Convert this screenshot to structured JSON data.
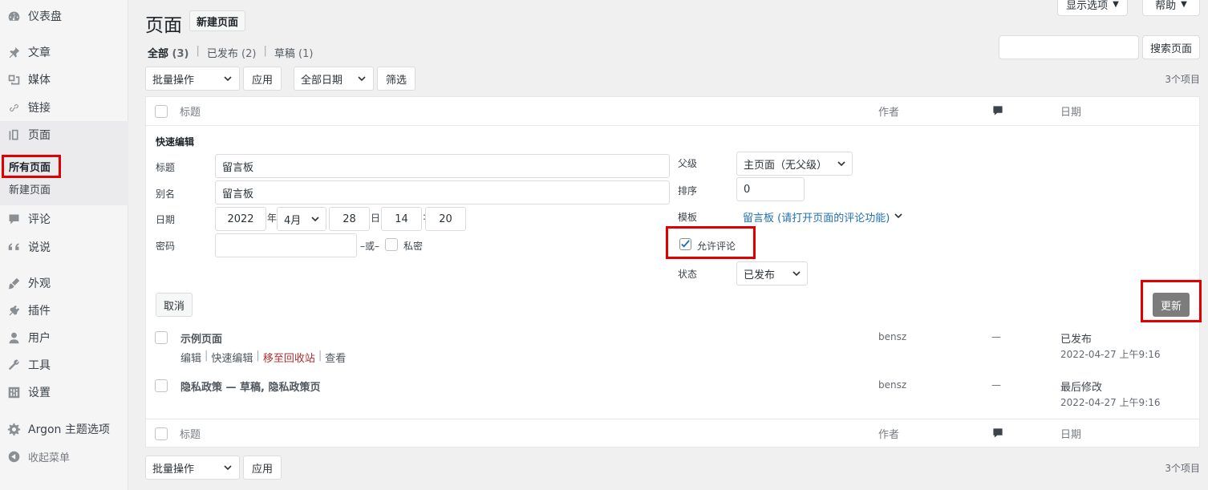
{
  "sidebar": {
    "items": [
      {
        "label": "仪表盘",
        "icon": "dashboard-icon"
      },
      {
        "label": "文章",
        "icon": "pin-icon"
      },
      {
        "label": "媒体",
        "icon": "media-icon"
      },
      {
        "label": "链接",
        "icon": "link-icon"
      },
      {
        "label": "页面",
        "icon": "pages-icon"
      },
      {
        "label": "评论",
        "icon": "comment-icon"
      },
      {
        "label": "说说",
        "icon": "quote-icon"
      },
      {
        "label": "外观",
        "icon": "brush-icon"
      },
      {
        "label": "插件",
        "icon": "plugin-icon"
      },
      {
        "label": "用户",
        "icon": "user-icon"
      },
      {
        "label": "工具",
        "icon": "wrench-icon"
      },
      {
        "label": "设置",
        "icon": "settings-icon"
      },
      {
        "label": "Argon 主题选项",
        "icon": "gear-icon"
      },
      {
        "label": "收起菜单",
        "icon": "collapse-icon"
      }
    ],
    "submenu": [
      {
        "label": "所有页面"
      },
      {
        "label": "新建页面"
      }
    ]
  },
  "header": {
    "title": "页面",
    "add_new": "新建页面",
    "screen_options": "显示选项",
    "help": "帮助"
  },
  "filters": [
    {
      "label": "全部",
      "count": "(3)"
    },
    {
      "label": "已发布",
      "count": "(2)"
    },
    {
      "label": "草稿",
      "count": "(1)"
    }
  ],
  "filter_sep": "|",
  "search": {
    "button": "搜索页面",
    "placeholder": ""
  },
  "toolbar": {
    "bulk_actions": "批量操作",
    "apply": "应用",
    "all_dates": "全部日期",
    "filter": "筛选",
    "item_count": "3个项目"
  },
  "table": {
    "columns": {
      "title": "标题",
      "author": "作者",
      "date": "日期"
    }
  },
  "quick_edit": {
    "heading": "快速编辑",
    "title_label": "标题",
    "title_value": "留言板",
    "slug_label": "别名",
    "slug_value": "留言板",
    "date_label": "日期",
    "year": "2022",
    "year_suffix": "年",
    "month": "4月",
    "day": "28",
    "day_suffix": "日",
    "hour": "14",
    "time_sep": ":",
    "minute": "20",
    "password_label": "密码",
    "password_value": "",
    "or": "–或–",
    "private": "私密",
    "parent_label": "父级",
    "parent_value": "主页面（无父级）",
    "order_label": "排序",
    "order_value": "0",
    "template_label": "模板",
    "template_value": "留言板 (请打开页面的评论功能)",
    "allow_comments": "允许评论",
    "status_label": "状态",
    "status_value": "已发布",
    "cancel": "取消",
    "update": "更新"
  },
  "rows": [
    {
      "title": "示例页面",
      "actions": [
        "编辑",
        "快速编辑",
        "移至回收站",
        "查看"
      ],
      "author": "bensz",
      "comments": "—",
      "status": "已发布",
      "date": "2022-04-27 上午9:16"
    },
    {
      "title": "隐私政策 — 草稿, 隐私政策页",
      "author": "bensz",
      "comments": "—",
      "status": "最后修改",
      "date": "2022-04-27 上午9:16"
    }
  ],
  "colors": {
    "highlight": "#e10000",
    "link": "#2271b1",
    "trash": "#b32d2e"
  }
}
